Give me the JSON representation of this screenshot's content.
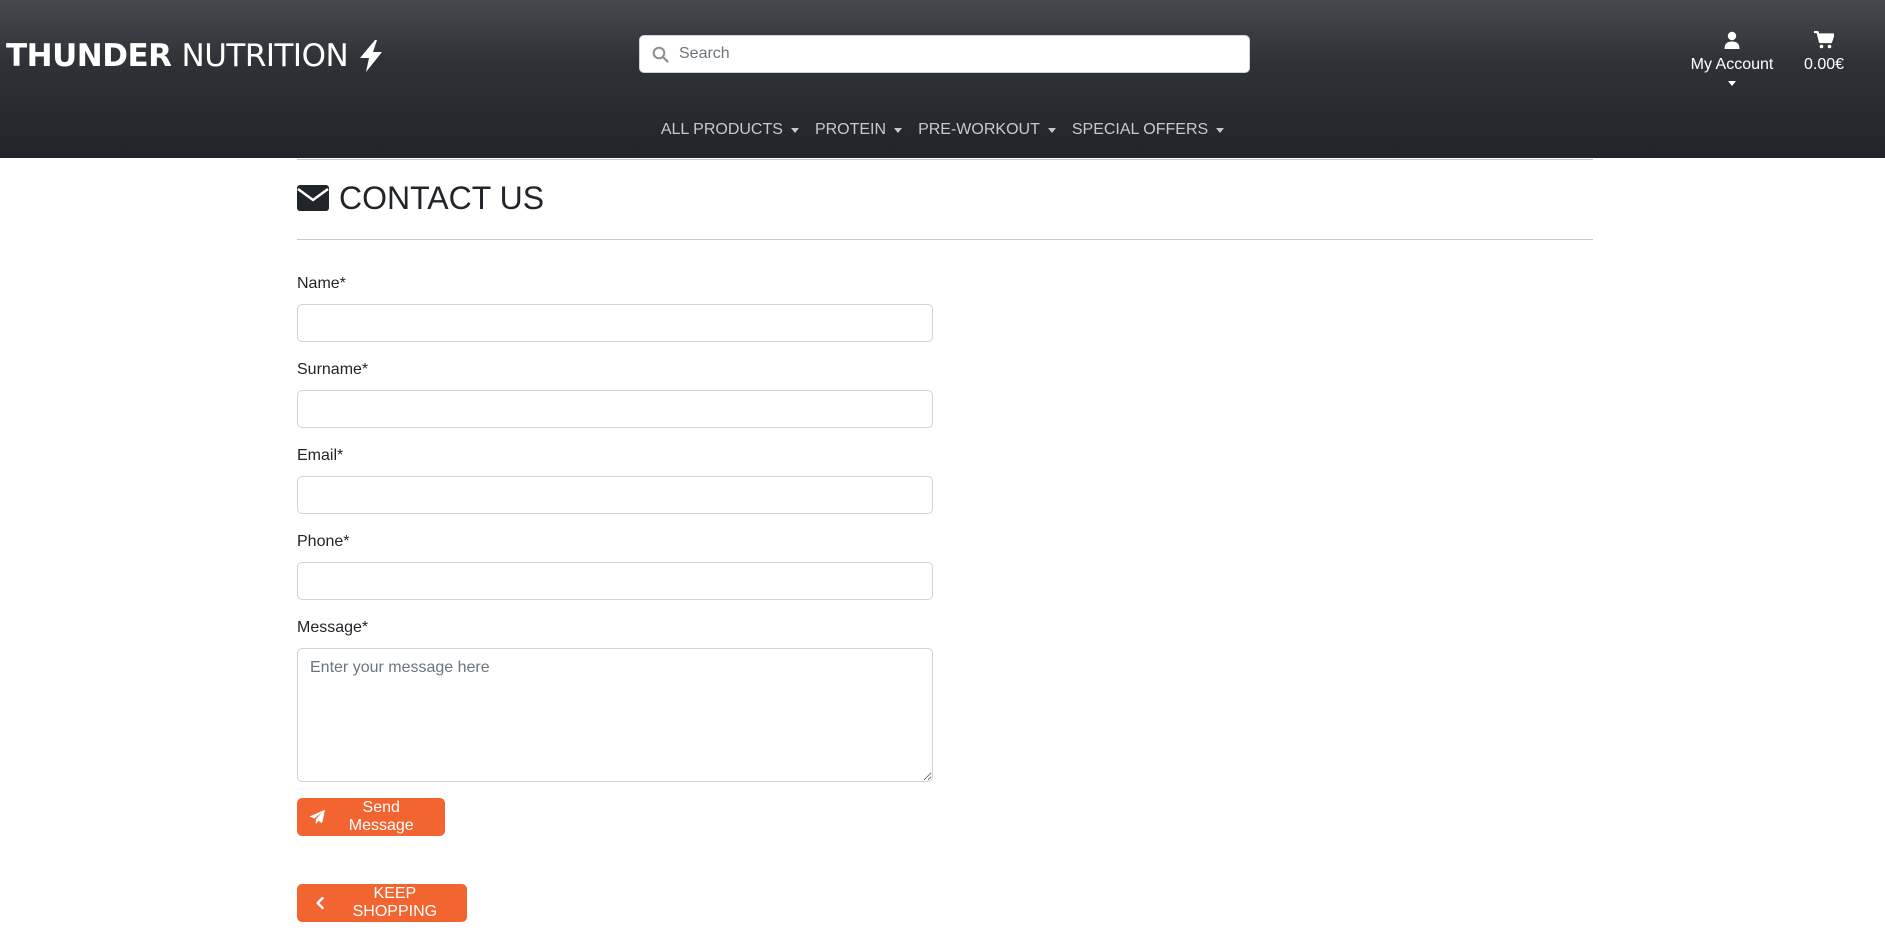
{
  "header": {
    "brand_part1": "THUNDER",
    "brand_part2": "NUTRITION",
    "search_placeholder": "Search",
    "account_label": "My Account",
    "cart_total": "0.00€"
  },
  "nav": {
    "items": [
      {
        "label": "ALL PRODUCTS"
      },
      {
        "label": "PROTEIN"
      },
      {
        "label": "PRE-WORKOUT"
      },
      {
        "label": "SPECIAL OFFERS"
      }
    ]
  },
  "page": {
    "title": "CONTACT US"
  },
  "form": {
    "name_label": "Name*",
    "surname_label": "Surname*",
    "email_label": "Email*",
    "phone_label": "Phone*",
    "message_label": "Message*",
    "message_placeholder": "Enter your message here",
    "send_label": "Send Message"
  },
  "actions": {
    "keep_shopping_label": "KEEP SHOPPING"
  },
  "colors": {
    "accent": "#f26430",
    "header_dark": "#212529",
    "header_light": "#464a4e"
  }
}
